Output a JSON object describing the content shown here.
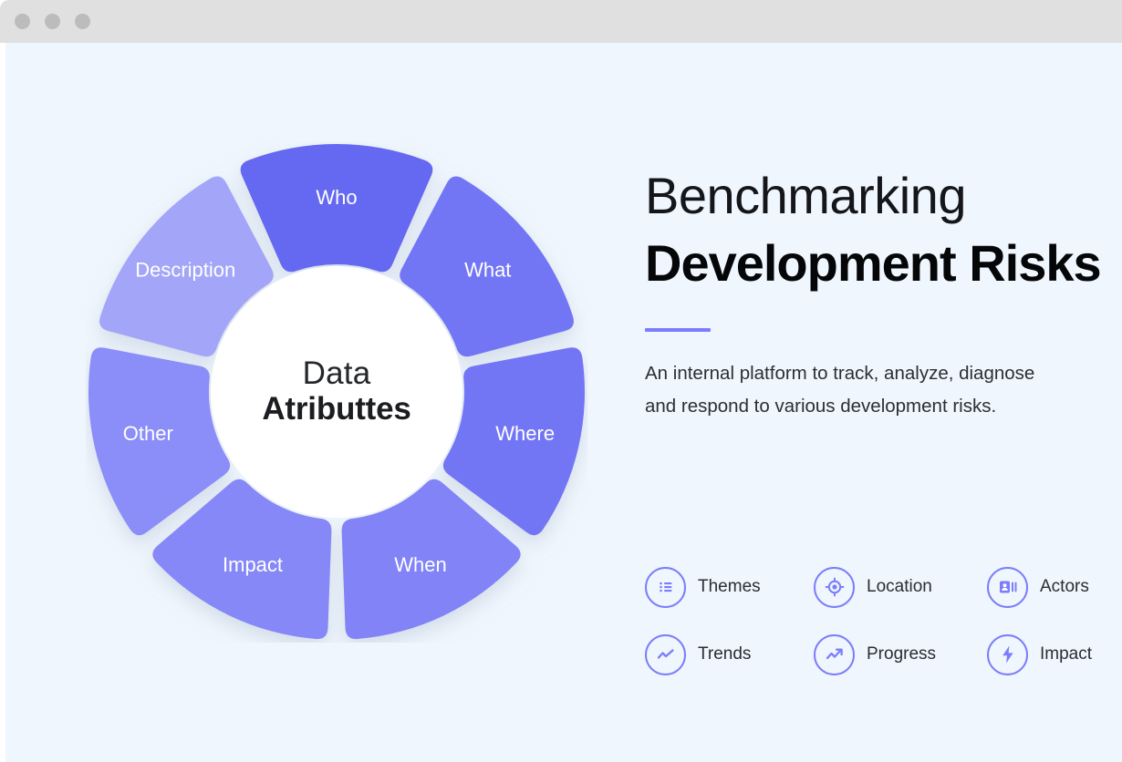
{
  "window": {
    "titlebar": {
      "traffic_lights": [
        "close-dot",
        "minimize-dot",
        "maximize-dot"
      ],
      "background_color": "#e0e0e0"
    },
    "canvas_background_color": "#eff6fd"
  },
  "donut": {
    "center": {
      "line1": "Data",
      "line2": "Atributtes"
    },
    "segments": [
      {
        "label": "Who",
        "color": "#6568f0"
      },
      {
        "label": "What",
        "color": "#7376f4"
      },
      {
        "label": "Where",
        "color": "#7376f4"
      },
      {
        "label": "When",
        "color": "#8183f6"
      },
      {
        "label": "Impact",
        "color": "#8688f7"
      },
      {
        "label": "Other",
        "color": "#8b8df8"
      },
      {
        "label": "Description",
        "color": "#a3a5f8"
      }
    ]
  },
  "content": {
    "title_light": "Benchmarking",
    "title_bold": "Development Risks",
    "accent_color": "#7b7dfb",
    "subtitle_line1": "An internal platform to track, analyze, diagnose",
    "subtitle_line2": "and respond to various development risks."
  },
  "features": [
    {
      "label": "Themes",
      "icon": "list-icon"
    },
    {
      "label": "Location",
      "icon": "crosshair-target-icon"
    },
    {
      "label": "Actors",
      "icon": "id-badge-icon"
    },
    {
      "label": "Trends",
      "icon": "zigzag-line-icon"
    },
    {
      "label": "Progress",
      "icon": "trend-arrow-up-icon"
    },
    {
      "label": "Impact",
      "icon": "lightning-bolt-icon"
    }
  ]
}
